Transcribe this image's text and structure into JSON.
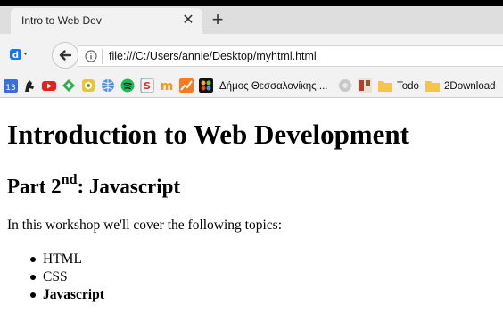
{
  "tab": {
    "title": "Intro to Web Dev",
    "close_glyph": "✕",
    "new_tab_glyph": "+"
  },
  "toolbar": {
    "url": "file:///C:/Users/annie/Desktop/myhtml.html",
    "back_icon": "back-arrow-icon",
    "info_icon": "info-icon"
  },
  "bookmarks": {
    "calendar_label": "13",
    "municipality_label": "Δήμος Θεσσαλονίκης ...",
    "todo_label": "Todo",
    "download_label": "2Download"
  },
  "page": {
    "h1": "Introduction to Web Development",
    "h2_prefix": "Part 2",
    "h2_sup": "nd",
    "h2_suffix": ": Javascript",
    "paragraph": "In this workshop we'll cover the following topics:",
    "topics": [
      "HTML",
      "CSS",
      "Javascript"
    ]
  },
  "colors": {
    "tabstrip": "#dedede",
    "toolbar": "#f2f2f2",
    "youtube_red": "#e62117",
    "spotify_green": "#1db954",
    "folder_yellow": "#f3c64a"
  }
}
